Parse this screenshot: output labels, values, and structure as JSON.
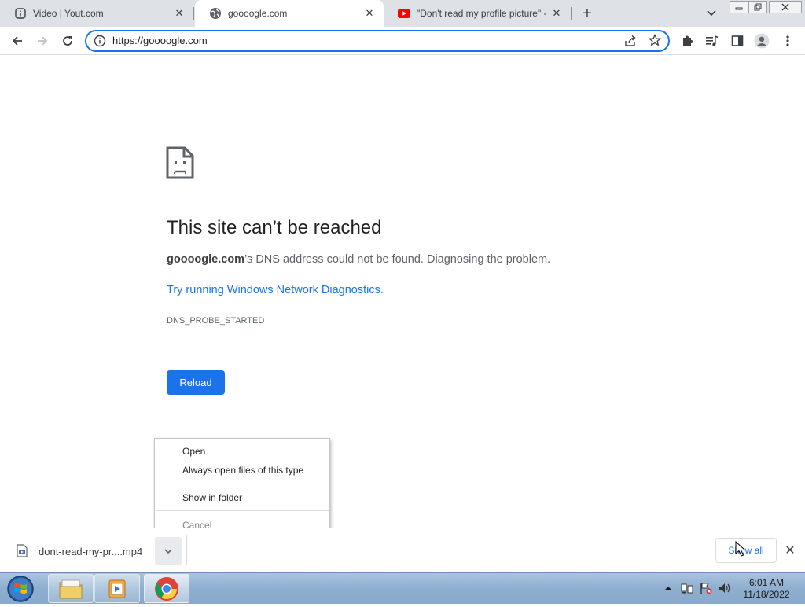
{
  "browser": {
    "tabs": [
      {
        "title": "Video | Yout.com",
        "icon": "info-circle-icon"
      },
      {
        "title": "goooogle.com",
        "icon": "globe-icon"
      },
      {
        "title": "\"Don't read my profile picture\" -",
        "icon": "youtube-icon"
      }
    ],
    "active_tab_index": 1,
    "url": "https://goooogle.com"
  },
  "error_page": {
    "title": "This site can’t be reached",
    "domain": "goooogle.com",
    "description_rest": "’s DNS address could not be found. Diagnosing the problem.",
    "link_text": "Try running Windows Network Diagnostics",
    "link_suffix": ".",
    "error_code": "DNS_PROBE_STARTED",
    "reload_label": "Reload"
  },
  "context_menu": {
    "items": [
      {
        "label": "Open",
        "enabled": true
      },
      {
        "label": "Always open files of this type",
        "enabled": true
      },
      {
        "label": "Show in folder",
        "enabled": true
      },
      {
        "label": "Cancel",
        "enabled": false
      }
    ]
  },
  "download_shelf": {
    "filename": "dont-read-my-pr....mp4",
    "show_all_label": "Show all"
  },
  "taskbar": {
    "time": "6:01 AM",
    "date": "11/18/2022",
    "pinned": [
      "file-explorer-icon",
      "media-player-icon",
      "chrome-icon"
    ]
  },
  "colors": {
    "accent": "#1a73e8",
    "tabstrip": "#dee1e6",
    "youtube_red": "#ff0000"
  }
}
